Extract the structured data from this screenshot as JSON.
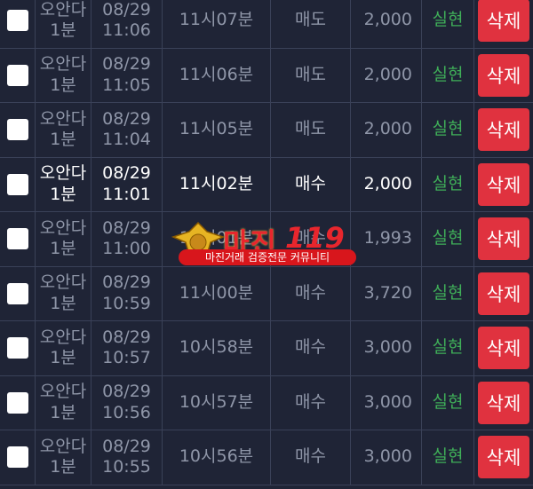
{
  "rows": [
    {
      "product_line1": "오안다",
      "product_line2": "1분",
      "date": "08/29",
      "clock": "11:06",
      "round": "11시07분",
      "side": "매도",
      "amount": "2,000",
      "status": "실현",
      "action": "삭제",
      "highlight": false
    },
    {
      "product_line1": "오안다",
      "product_line2": "1분",
      "date": "08/29",
      "clock": "11:05",
      "round": "11시06분",
      "side": "매도",
      "amount": "2,000",
      "status": "실현",
      "action": "삭제",
      "highlight": false
    },
    {
      "product_line1": "오안다",
      "product_line2": "1분",
      "date": "08/29",
      "clock": "11:04",
      "round": "11시05분",
      "side": "매도",
      "amount": "2,000",
      "status": "실현",
      "action": "삭제",
      "highlight": false
    },
    {
      "product_line1": "오안다",
      "product_line2": "1분",
      "date": "08/29",
      "clock": "11:01",
      "round": "11시02분",
      "side": "매수",
      "amount": "2,000",
      "status": "실현",
      "action": "삭제",
      "highlight": true
    },
    {
      "product_line1": "오안다",
      "product_line2": "1분",
      "date": "08/29",
      "clock": "11:00",
      "round": "11시01분",
      "side": "매수",
      "amount": "1,993",
      "status": "실현",
      "action": "삭제",
      "highlight": false
    },
    {
      "product_line1": "오안다",
      "product_line2": "1분",
      "date": "08/29",
      "clock": "10:59",
      "round": "11시00분",
      "side": "매수",
      "amount": "3,720",
      "status": "실현",
      "action": "삭제",
      "highlight": false
    },
    {
      "product_line1": "오안다",
      "product_line2": "1분",
      "date": "08/29",
      "clock": "10:57",
      "round": "10시58분",
      "side": "매수",
      "amount": "3,000",
      "status": "실현",
      "action": "삭제",
      "highlight": false
    },
    {
      "product_line1": "오안다",
      "product_line2": "1분",
      "date": "08/29",
      "clock": "10:56",
      "round": "10시57분",
      "side": "매수",
      "amount": "3,000",
      "status": "실현",
      "action": "삭제",
      "highlight": false
    },
    {
      "product_line1": "오안다",
      "product_line2": "1분",
      "date": "08/29",
      "clock": "10:55",
      "round": "10시56분",
      "side": "매수",
      "amount": "3,000",
      "status": "실현",
      "action": "삭제",
      "highlight": false
    }
  ],
  "watermark": {
    "title": "마진",
    "number": "119",
    "tagline": "마진거래 검증전문 커뮤니티"
  },
  "colors": {
    "background": "#1f2436",
    "realized_green": "#3fae58",
    "delete_red": "#e0323f"
  }
}
